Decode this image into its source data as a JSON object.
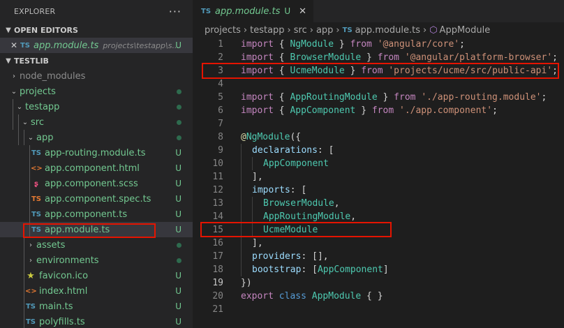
{
  "explorer": {
    "title": "EXPLORER",
    "more": "···",
    "open_editors": {
      "label": "OPEN EDITORS",
      "items": [
        {
          "icon": "TS",
          "name": "app.module.ts",
          "path": "projects\\testapp\\s...",
          "status": "U",
          "close": "✕"
        }
      ]
    },
    "workspace": {
      "label": "TESTLIB",
      "tree": [
        {
          "label": "node_modules"
        },
        {
          "label": "projects"
        },
        {
          "label": "testapp"
        },
        {
          "label": "src"
        },
        {
          "label": "app"
        },
        {
          "label": "app-routing.module.ts",
          "icon": "TS",
          "status": "U"
        },
        {
          "label": "app.component.html",
          "icon": "<>",
          "status": "U"
        },
        {
          "label": "app.component.scss",
          "status": "U"
        },
        {
          "label": "app.component.spec.ts",
          "icon": "TS",
          "status": "U"
        },
        {
          "label": "app.component.ts",
          "icon": "TS",
          "status": "U"
        },
        {
          "label": "app.module.ts",
          "icon": "TS",
          "status": "U"
        },
        {
          "label": "assets"
        },
        {
          "label": "environments"
        },
        {
          "label": "favicon.ico",
          "icon": "★",
          "status": "U"
        },
        {
          "label": "index.html",
          "icon": "<>",
          "status": "U"
        },
        {
          "label": "main.ts",
          "icon": "TS",
          "status": "U"
        },
        {
          "label": "polyfills.ts",
          "icon": "TS",
          "status": "U"
        }
      ]
    }
  },
  "editor": {
    "tab": {
      "icon": "TS",
      "name": "app.module.ts",
      "status": "U",
      "close": "✕"
    },
    "breadcrumb": [
      "projects",
      "testapp",
      "src",
      "app",
      "app.module.ts",
      "AppModule"
    ],
    "breadcrumb_file_icon": "TS",
    "lines": [
      "import { NgModule } from '@angular/core';",
      "import { BrowserModule } from '@angular/platform-browser';",
      "import { UcmeModule } from 'projects/ucme/src/public-api';",
      "",
      "import { AppRoutingModule } from './app-routing.module';",
      "import { AppComponent } from './app.component';",
      "",
      "@NgModule({",
      "declarations: [",
      "AppComponent",
      "],",
      "imports: [",
      "BrowserModule,",
      "AppRoutingModule,",
      "UcmeModule",
      "],",
      "providers: [],",
      "bootstrap: [AppComponent]",
      "})",
      "export class AppModule { }",
      ""
    ],
    "line_numbers": [
      "1",
      "2",
      "3",
      "4",
      "5",
      "6",
      "7",
      "8",
      "9",
      "10",
      "11",
      "12",
      "13",
      "14",
      "15",
      "16",
      "17",
      "18",
      "19",
      "20",
      "21"
    ],
    "current_line": "19"
  }
}
